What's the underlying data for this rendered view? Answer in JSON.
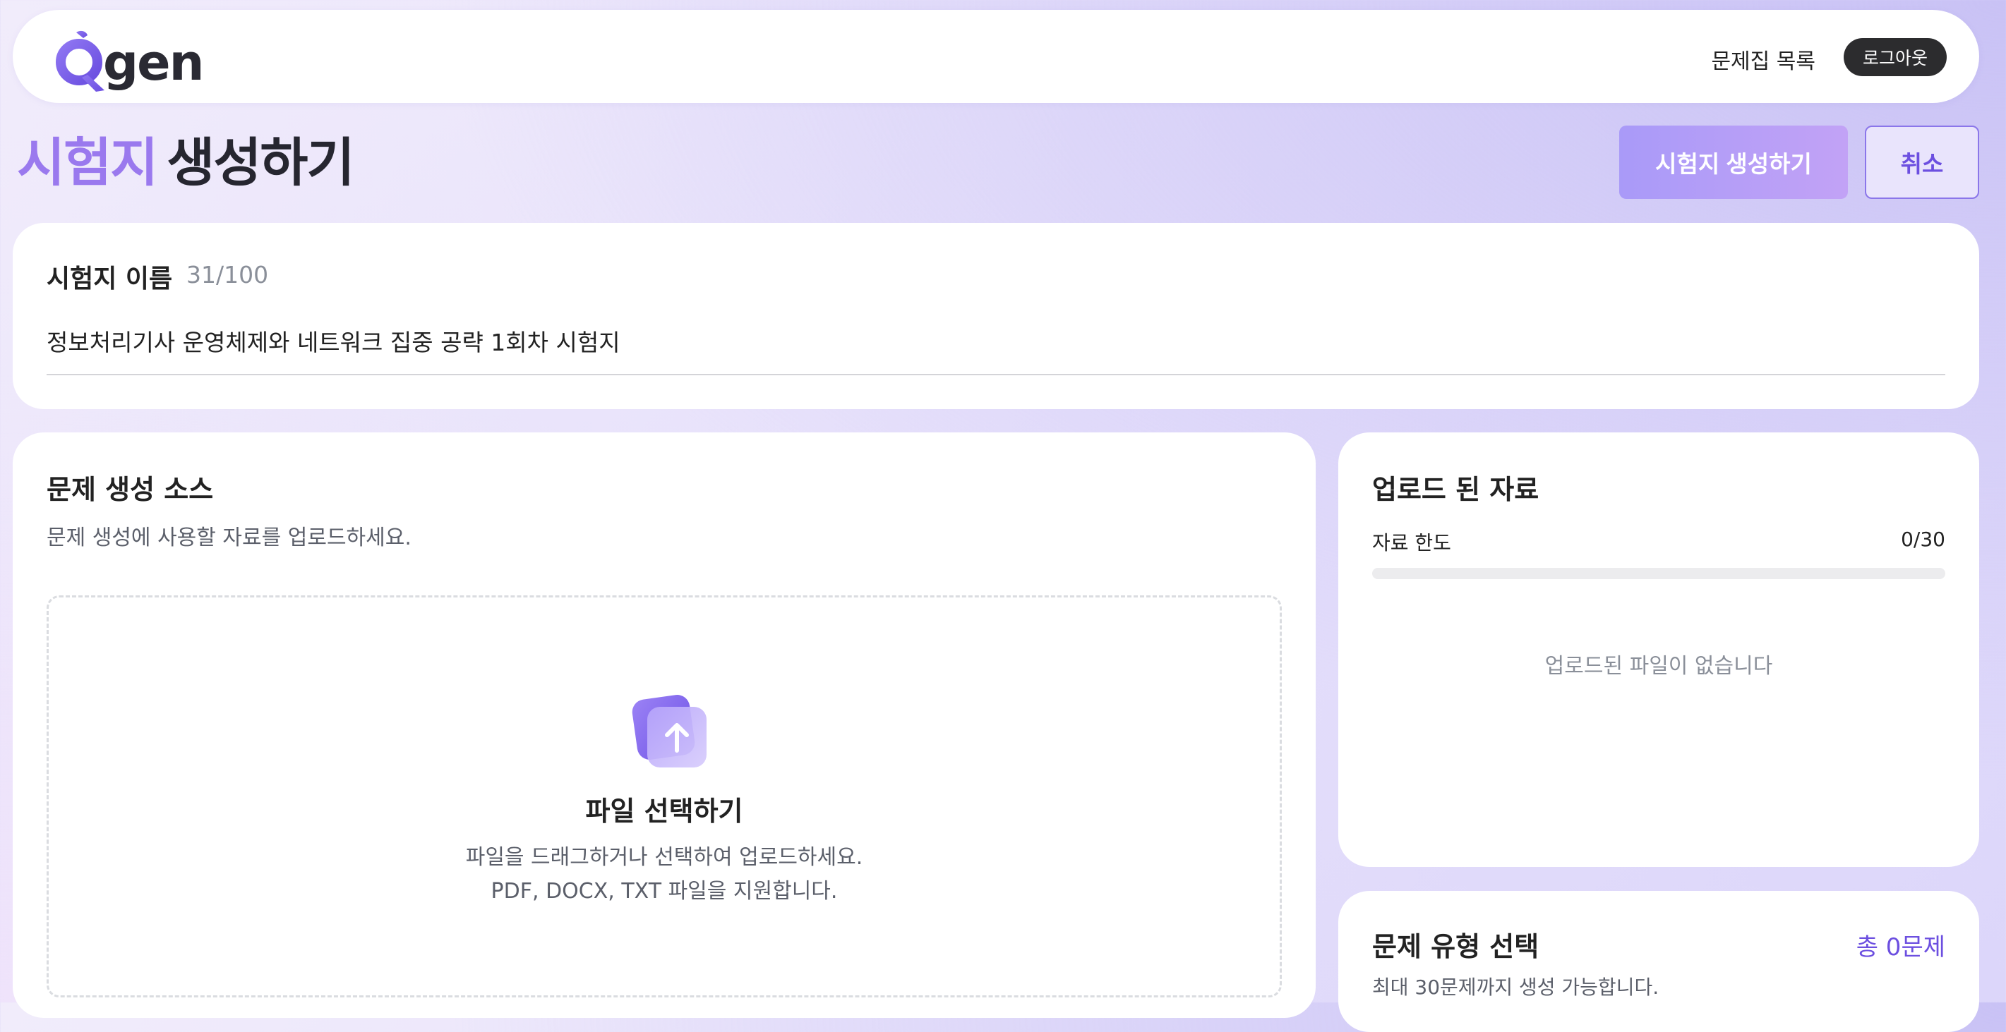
{
  "header": {
    "logo_text": "gen",
    "logo_letter": "Q",
    "nav_link": "문제집 목록",
    "logout_label": "로그아웃"
  },
  "page": {
    "title_accent": "시험지",
    "title_rest": "생성하기",
    "create_label": "시험지 생성하기",
    "cancel_label": "취소"
  },
  "exam_name": {
    "label": "시험지 이름",
    "count": "31/100",
    "value": "정보처리기사 운영체제와 네트워크 집중 공략 1회차 시험지"
  },
  "source": {
    "title": "문제 생성 소스",
    "subtitle": "문제 생성에 사용할 자료를 업로드하세요.",
    "upload_title": "파일 선택하기",
    "upload_desc1": "파일을 드래그하거나 선택하여 업로드하세요.",
    "upload_desc2": "PDF, DOCX, TXT 파일을 지원합니다."
  },
  "uploaded": {
    "title": "업로드 된 자료",
    "quota_label": "자료 한도",
    "quota_value": "0/30",
    "quota_fraction": 0,
    "empty_text": "업로드된 파일이 없습니다"
  },
  "question_type": {
    "title": "문제 유형 선택",
    "total": "총 0문제",
    "subtitle": "최대 30문제까지 생성 가능합니다."
  },
  "colors": {
    "accent": "#9a79ee",
    "primary_button": "#a99af8",
    "dark_button": "#2c2c2e"
  }
}
